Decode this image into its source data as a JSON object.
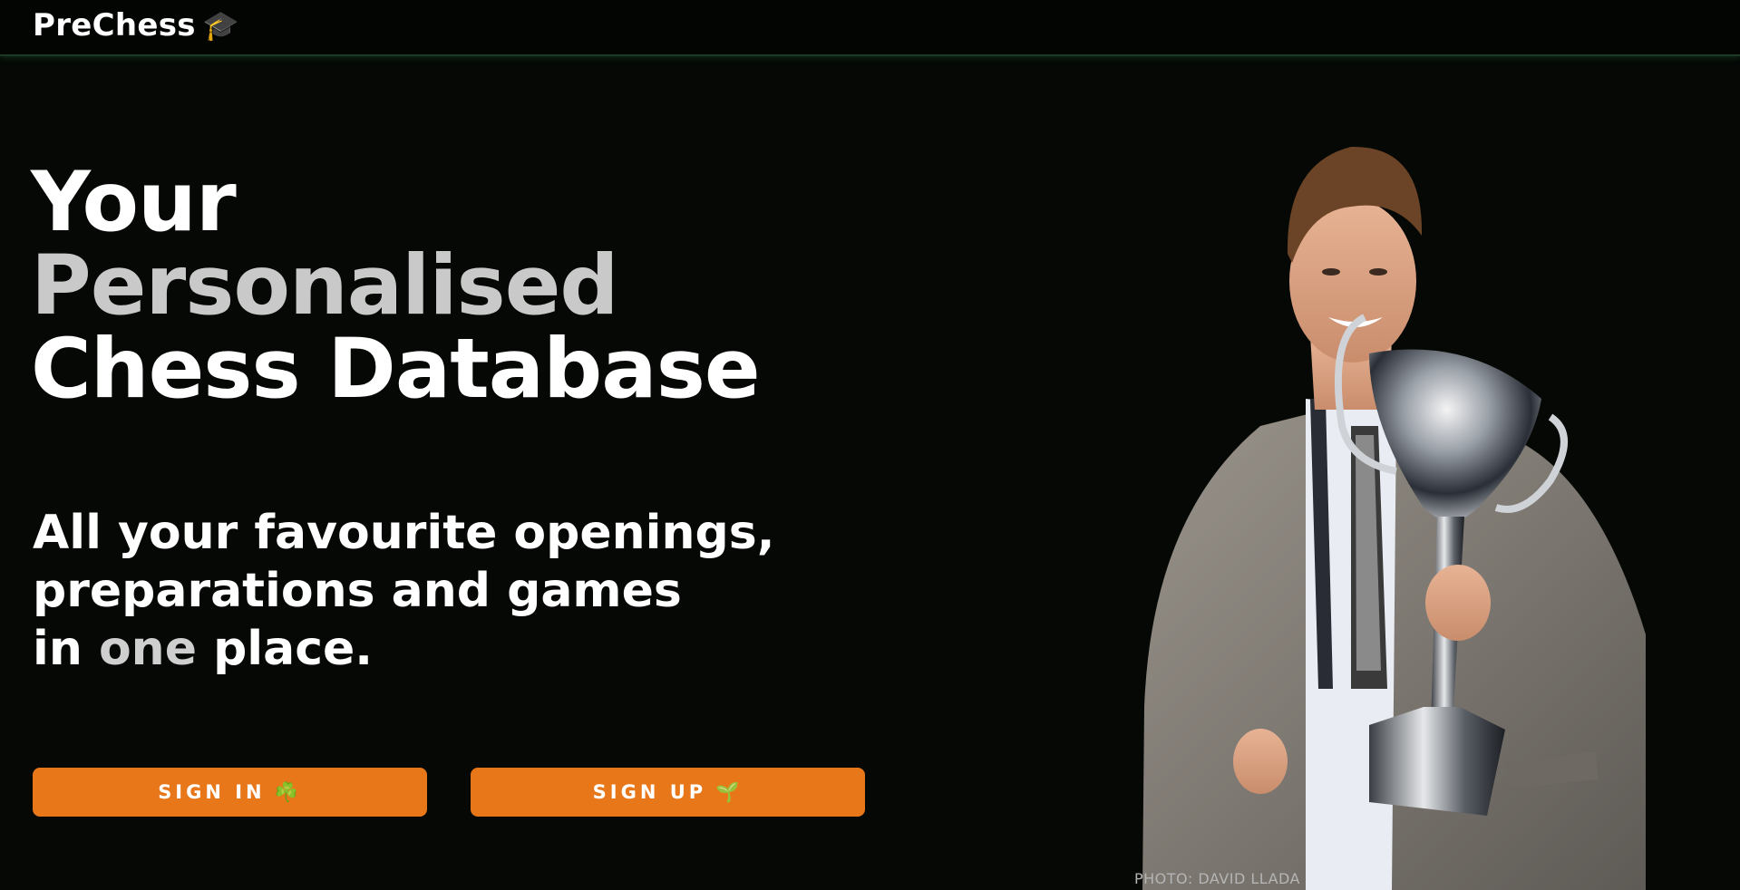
{
  "header": {
    "brand": "PreChess",
    "brand_icon": "🎓",
    "brand_icon_name": "graduation-cap-icon"
  },
  "hero": {
    "title_line1": "Your",
    "title_line2": "Personalised",
    "title_line3": "Chess Database",
    "tagline_line1": "All your favourite openings,",
    "tagline_line2": "preparations and games",
    "tagline_line3_prefix": "in ",
    "tagline_line3_highlight": "one",
    "tagline_line3_suffix": " place."
  },
  "actions": {
    "signin_label": "SIGN IN",
    "signin_icon": "☘️",
    "signup_label": "SIGN UP",
    "signup_icon": "🌱"
  },
  "photo": {
    "credit": "PHOTO: DAVID LLADA",
    "subject": "chess player holding trophy"
  },
  "colors": {
    "background": "#050805",
    "accent": "#e8771a",
    "muted_text": "#c9c9c9",
    "header_border": "#1d3a24"
  }
}
